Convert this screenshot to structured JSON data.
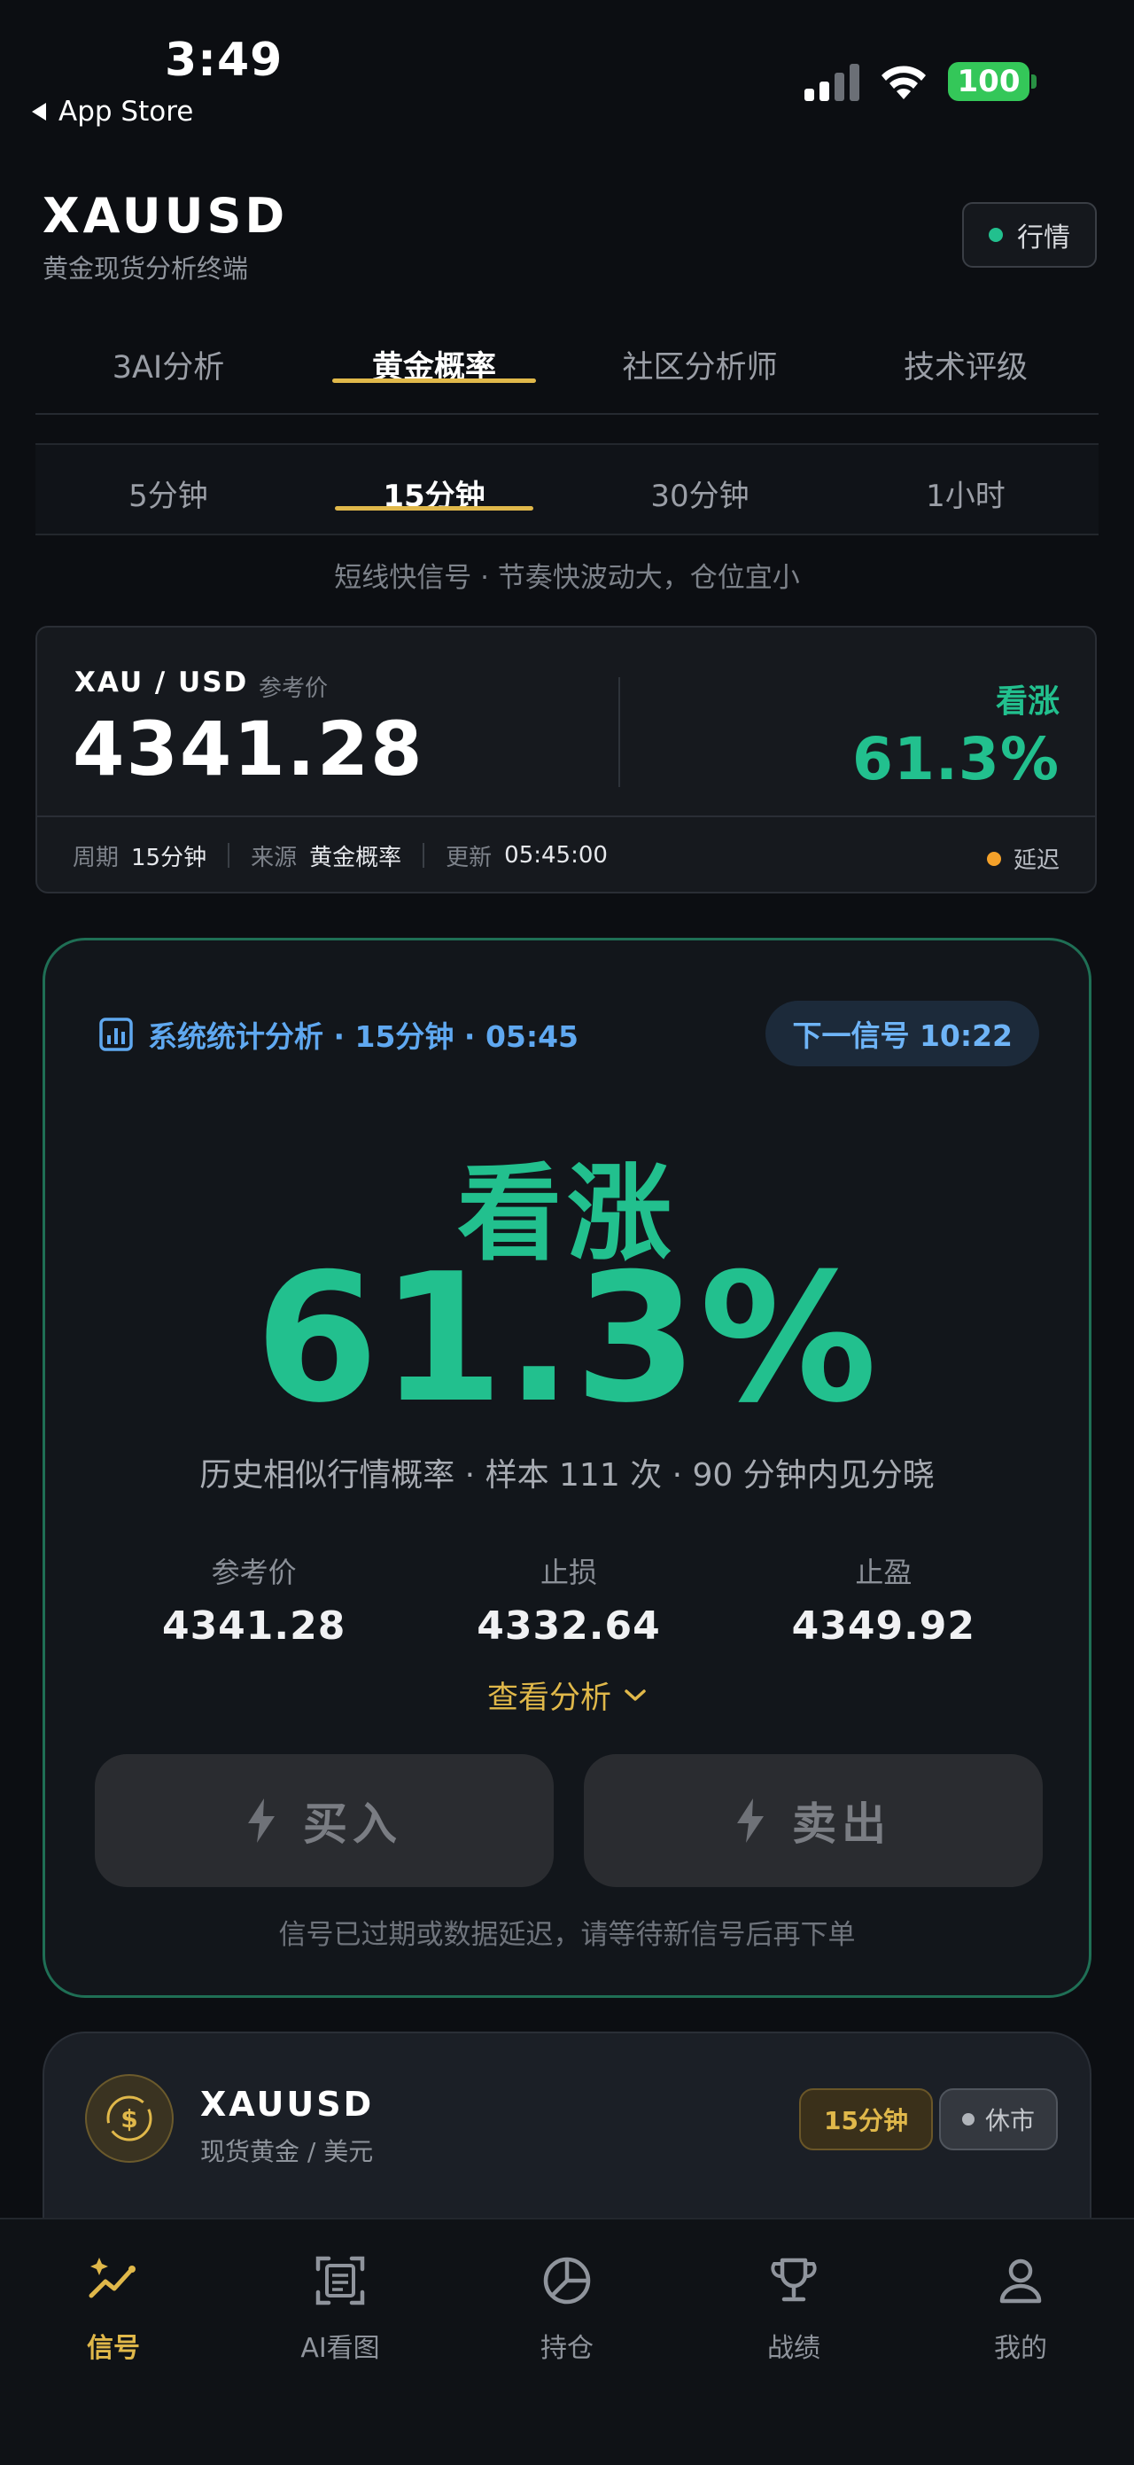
{
  "status_bar": {
    "time": "3:49",
    "back_label": "App Store",
    "battery": "100"
  },
  "header": {
    "title": "XAUUSD",
    "subtitle": "黄金现货分析终端",
    "market_button": "行情"
  },
  "main_tabs": [
    {
      "label": "3AI分析"
    },
    {
      "label": "黄金概率",
      "active": true
    },
    {
      "label": "社区分析师"
    },
    {
      "label": "技术评级"
    }
  ],
  "sub_tabs": [
    {
      "label": "5分钟"
    },
    {
      "label": "15分钟",
      "active": true
    },
    {
      "label": "30分钟"
    },
    {
      "label": "1小时"
    }
  ],
  "tagline": "短线快信号 · 节奏快波动大，仓位宜小",
  "price_card": {
    "pair": "XAU / USD",
    "ref_label": "参考价",
    "price": "4341.28",
    "direction": "看涨",
    "probability": "61.3%",
    "period_label": "周期",
    "period_value": "15分钟",
    "source_label": "来源",
    "source_value": "黄金概率",
    "update_label": "更新",
    "update_value": "05:45:00",
    "delay_label": "延迟"
  },
  "signal_card": {
    "header": "系统统计分析 · 15分钟 · 05:45",
    "next_signal": "下一信号 10:22",
    "direction": "看涨",
    "probability": "61.3%",
    "history_text": "历史相似行情概率 · 样本 111 次 · 90 分钟内见分晓",
    "levels": [
      {
        "label": "参考价",
        "value": "4341.28"
      },
      {
        "label": "止损",
        "value": "4332.64"
      },
      {
        "label": "止盈",
        "value": "4349.92"
      }
    ],
    "view_analysis": "查看分析",
    "buy_label": "买入",
    "sell_label": "卖出",
    "notice": "信号已过期或数据延迟，请等待新信号后再下单"
  },
  "asset_card": {
    "symbol": "XAUUSD",
    "description": "现货黄金 / 美元",
    "timeframe_chip": "15分钟",
    "market_status": "休市"
  },
  "bottom_nav": [
    {
      "label": "信号",
      "icon": "signal-chart-icon",
      "active": true
    },
    {
      "label": "AI看图",
      "icon": "ai-scan-icon"
    },
    {
      "label": "持仓",
      "icon": "pie-chart-icon"
    },
    {
      "label": "战绩",
      "icon": "trophy-icon"
    },
    {
      "label": "我的",
      "icon": "user-icon"
    }
  ],
  "colors": {
    "bullish": "#22c08e",
    "accent_gold": "#e0b84a",
    "info_blue": "#5fa8f0",
    "delay_orange": "#f4a12a"
  }
}
